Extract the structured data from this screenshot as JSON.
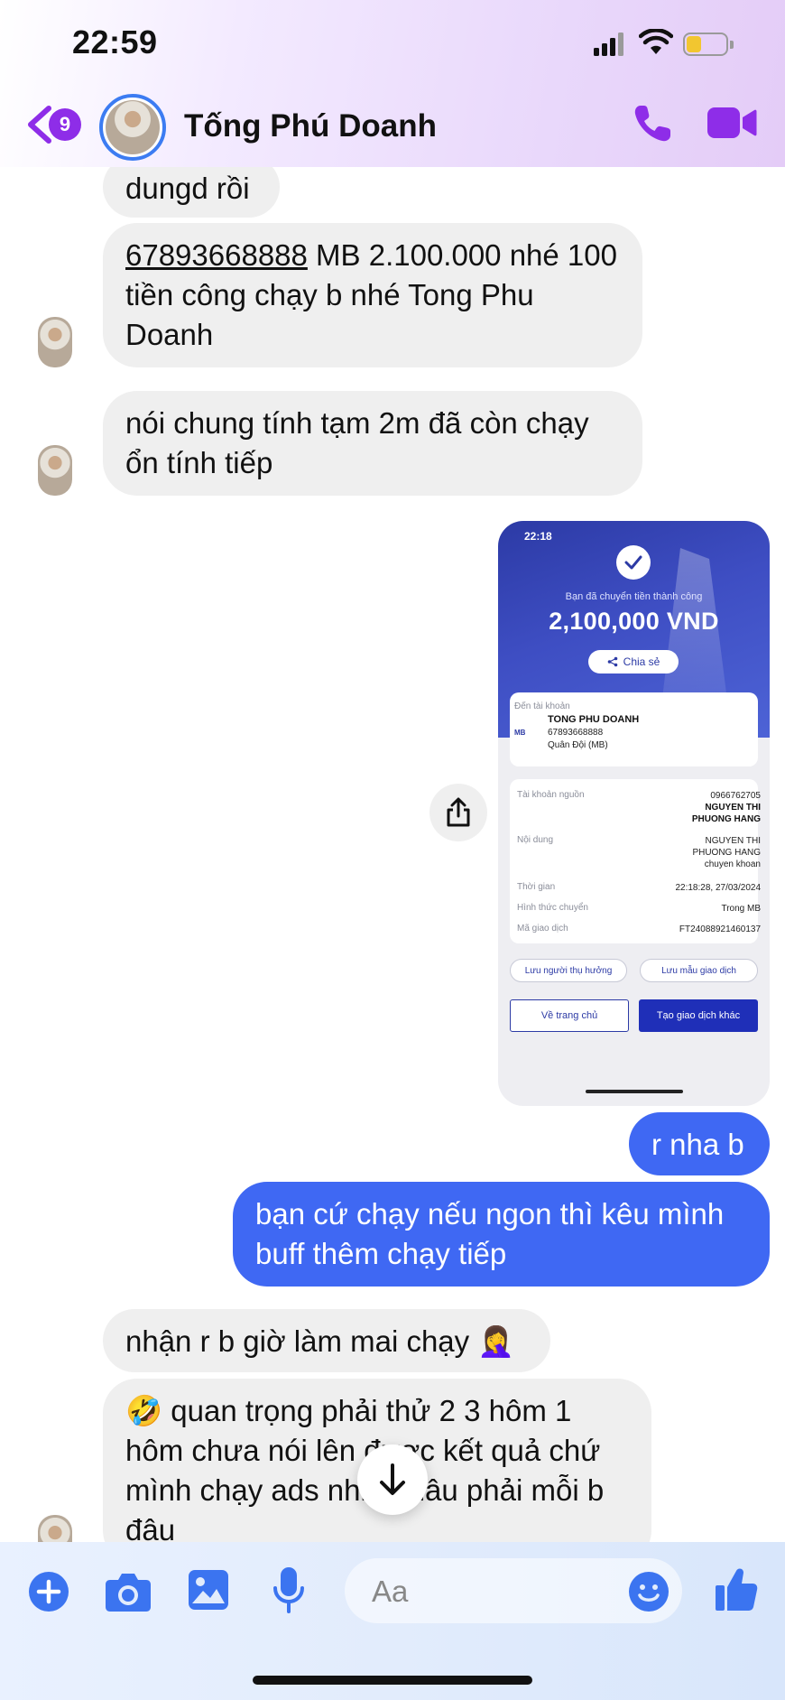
{
  "status_bar": {
    "time": "22:59"
  },
  "header": {
    "back_badge": "9",
    "contact_name": "Tống Phú Doanh"
  },
  "messages": [
    {
      "side": "in",
      "text": "dungd rồi"
    },
    {
      "side": "in",
      "account_link": "67893668888",
      "text_after_link": " MB 2.100.000 nhé 100 tiền công chạy b nhé Tong Phu Doanh"
    },
    {
      "side": "in",
      "text": "nói chung tính tạm 2m đã còn chạy ổn tính tiếp"
    },
    {
      "side": "out",
      "type": "image"
    },
    {
      "side": "out",
      "text": "r nha b"
    },
    {
      "side": "out",
      "text": "bạn cứ chạy nếu ngon thì kêu mình buff thêm chạy tiếp"
    },
    {
      "side": "in",
      "text": "nhận r b giờ làm mai chạy 🤦‍♀️"
    },
    {
      "side": "in",
      "text": "🤣 quan trọng phải thử 2 3 hôm 1 hôm chưa nói lên được kết quả chứ mình chạy ads nhiều đâu phải mỗi b đâu"
    }
  ],
  "receipt": {
    "time": "22:18",
    "success_text": "Bạn đã chuyển tiền thành công",
    "amount": "2,100,000 VND",
    "share_label": "Chia sẻ",
    "to_account_label": "Đến tài khoản",
    "recipient_name": "TONG PHU DOANH",
    "recipient_account": "67893668888",
    "recipient_bank": "Quân Đội (MB)",
    "bank_logo": "MB",
    "source_label": "Tài khoản nguồn",
    "source_account": "0966762705",
    "source_name_1": "NGUYEN THI",
    "source_name_2": "PHUONG HANG",
    "content_label": "Nội dung",
    "content_1": "NGUYEN THI",
    "content_2": "PHUONG HANG",
    "content_3": "chuyen khoan",
    "time_label": "Thời gian",
    "time_value": "22:18:28, 27/03/2024",
    "method_label": "Hình thức chuyển",
    "method_value": "Trong MB",
    "txn_label": "Mã giao dịch",
    "txn_value": "FT24088921460137",
    "save_beneficiary": "Lưu người thụ hưởng",
    "save_template": "Lưu mẫu giao dịch",
    "home_button": "Về trang chủ",
    "new_txn_button": "Tạo giao dịch khác"
  },
  "composer": {
    "placeholder": "Aa"
  },
  "colors": {
    "accent": "#8e2de8",
    "outgoing_bubble": "#3f68f3",
    "incoming_bubble": "#efefef",
    "composer_icons": "#3b74f0"
  }
}
